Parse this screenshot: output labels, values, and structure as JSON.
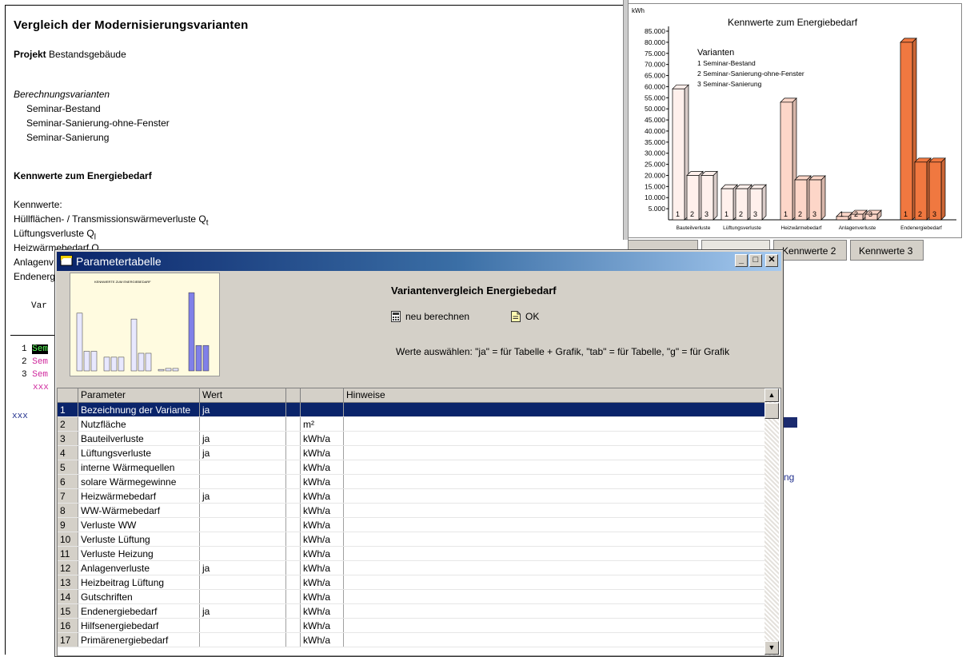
{
  "report": {
    "title": "Vergleich der Modernisierungsvarianten",
    "projekt_label": "Projekt",
    "projekt_value": "Bestandsgebäude",
    "berechnungsvarianten_label": "Berechnungsvarianten",
    "variants": [
      "Seminar-Bestand",
      "Seminar-Sanierung-ohne-Fenster",
      "Seminar-Sanierung"
    ],
    "section_heading": "Kennwerte zum Energiebedarf",
    "kennwerte_label": "Kennwerte:",
    "kennwerte_lines": [
      "Hüllflächen- / Transmissionswärmeverluste Q",
      "Lüftungsverluste Q",
      "Heizwärmebedarf Q",
      "Anlagenv",
      "Endenerg"
    ],
    "kennwerte_subscripts": [
      "t",
      "l"
    ],
    "mono_var": "Var",
    "mono_rows": [
      {
        "n": "1",
        "t": "Sem"
      },
      {
        "n": "2",
        "t": "Sem"
      },
      {
        "n": "3",
        "t": "Sem"
      },
      {
        "n": "",
        "t": "xxx"
      }
    ],
    "xxx_label": "xxx",
    "fragment_ng": "ng"
  },
  "colors": {
    "accent_green": "#1a5e1a",
    "magenta": "#d02a9e",
    "navy": "#1f2e8c",
    "chart_light": "#fff0ec",
    "chart_pink": "#fdd6c8",
    "chart_orange": "#f07840"
  },
  "chart_data": {
    "type": "bar",
    "title": "Kennwerte zum Energiebedarf",
    "ylabel": "kWh",
    "ylim": [
      0,
      85000
    ],
    "yticks": [
      "5.000",
      "10.000",
      "15.000",
      "20.000",
      "25.000",
      "30.000",
      "35.000",
      "40.000",
      "45.000",
      "50.000",
      "55.000",
      "60.000",
      "65.000",
      "70.000",
      "75.000",
      "80.000",
      "85.000"
    ],
    "categories": [
      "Bauteilverluste",
      "Lüftungsverluste",
      "Heizwärmebedarf",
      "Anlagenverluste",
      "Endenergiebedarf"
    ],
    "legend_title": "Varianten",
    "legend_position": "top-left",
    "series": [
      {
        "name": "1  Seminar-Bestand",
        "values": [
          59000,
          14000,
          53000,
          1500,
          80000
        ]
      },
      {
        "name": "2  Seminar-Sanierung-ohne-Fenster",
        "values": [
          20000,
          14000,
          18000,
          2500,
          26000
        ]
      },
      {
        "name": "3  Seminar-Sanierung",
        "values": [
          20000,
          14000,
          18000,
          2500,
          26000
        ]
      }
    ],
    "bar_labels": [
      "1",
      "2",
      "3"
    ]
  },
  "tabs": [
    {
      "label": "Kennwerte 2"
    },
    {
      "label": "Kennwerte 3"
    }
  ],
  "dialog": {
    "title": "Parametertabelle",
    "heading": "Variantenvergleich Energiebedarf",
    "recalc_label": "neu berechnen",
    "ok_label": "OK",
    "hint": "Werte auswählen: \"ja\" = für Tabelle + Grafik, \"tab\" = für Tabelle, \"g\" = für Grafik",
    "thumb_title": "KENNWERTE ZUM ENERGIEBEDARF",
    "columns": [
      "Parameter",
      "Wert",
      "",
      "",
      "Hinweise"
    ],
    "rows": [
      {
        "n": "1",
        "param": "Bezeichnung der Variante",
        "wert": "ja",
        "unit": ""
      },
      {
        "n": "2",
        "param": "Nutzfläche",
        "wert": "",
        "unit": "m²"
      },
      {
        "n": "3",
        "param": "Bauteilverluste",
        "wert": "ja",
        "unit": "kWh/a"
      },
      {
        "n": "4",
        "param": "Lüftungsverluste",
        "wert": "ja",
        "unit": "kWh/a"
      },
      {
        "n": "5",
        "param": "interne Wärmequellen",
        "wert": "",
        "unit": "kWh/a"
      },
      {
        "n": "6",
        "param": "solare Wärmegewinne",
        "wert": "",
        "unit": "kWh/a"
      },
      {
        "n": "7",
        "param": "Heizwärmebedarf",
        "wert": "ja",
        "unit": "kWh/a"
      },
      {
        "n": "8",
        "param": "WW-Wärmebedarf",
        "wert": "",
        "unit": "kWh/a"
      },
      {
        "n": "9",
        "param": "Verluste WW",
        "wert": "",
        "unit": "kWh/a"
      },
      {
        "n": "10",
        "param": "Verluste Lüftung",
        "wert": "",
        "unit": "kWh/a"
      },
      {
        "n": "11",
        "param": "Verluste Heizung",
        "wert": "",
        "unit": "kWh/a"
      },
      {
        "n": "12",
        "param": "Anlagenverluste",
        "wert": "ja",
        "unit": "kWh/a"
      },
      {
        "n": "13",
        "param": "Heizbeitrag Lüftung",
        "wert": "",
        "unit": "kWh/a"
      },
      {
        "n": "14",
        "param": "Gutschriften",
        "wert": "",
        "unit": "kWh/a"
      },
      {
        "n": "15",
        "param": "Endenergiebedarf",
        "wert": "ja",
        "unit": "kWh/a"
      },
      {
        "n": "16",
        "param": "Hilfsenergiebedarf",
        "wert": "",
        "unit": "kWh/a"
      },
      {
        "n": "17",
        "param": "Primärenergiebedarf",
        "wert": "",
        "unit": "kWh/a"
      }
    ],
    "selected_row": 0
  }
}
